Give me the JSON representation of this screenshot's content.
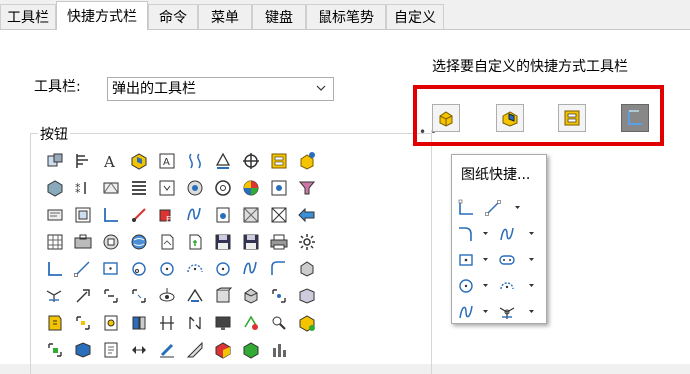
{
  "tabs": [
    {
      "label": "工具栏",
      "active": false
    },
    {
      "label": "快捷方式栏",
      "active": true
    },
    {
      "label": "命令",
      "active": false
    },
    {
      "label": "菜单",
      "active": false
    },
    {
      "label": "键盘",
      "active": false
    },
    {
      "label": "鼠标笔势",
      "active": false
    },
    {
      "label": "自定义",
      "active": false
    }
  ],
  "toolbar_field": {
    "label": "工具栏:",
    "selected": "弹出的工具栏"
  },
  "buttons_group": {
    "title": "按钮"
  },
  "shortcut_bar": {
    "prompt": "选择要自定义的快捷方式工具栏",
    "items": [
      {
        "icon": "part-shortcut-icon",
        "selected": false
      },
      {
        "icon": "assembly-shortcut-icon",
        "selected": false
      },
      {
        "icon": "drawing-shortcut-icon",
        "selected": false
      },
      {
        "icon": "sketch-shortcut-icon",
        "selected": true
      }
    ]
  },
  "popup": {
    "title": "图纸快捷..."
  },
  "colors": {
    "accent_red": "#e00000",
    "icon_blue": "#2a6ebb",
    "icon_yellow": "#f5c400"
  }
}
